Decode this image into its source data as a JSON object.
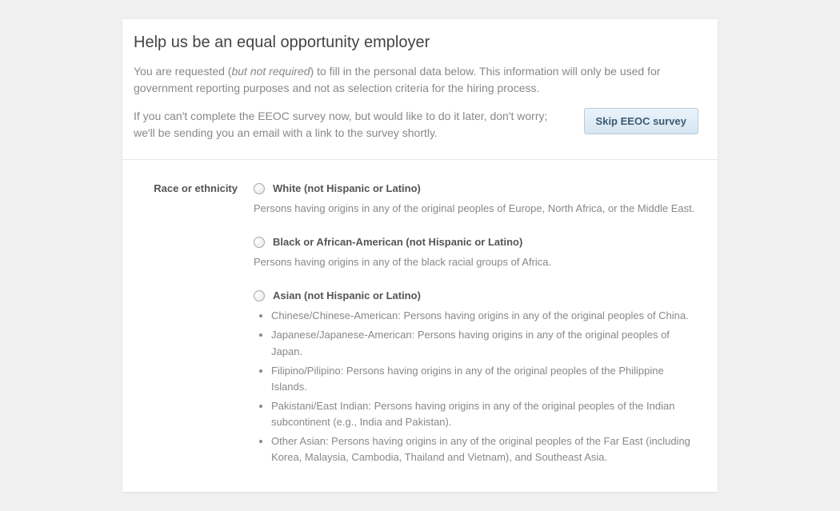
{
  "header": {
    "title": "Help us be an equal opportunity employer",
    "intro_pre": "You are requested (",
    "intro_em": "but not required",
    "intro_post": ") to fill in the personal data below. This information will only be used for government reporting purposes and not as selection criteria for the hiring process.",
    "skip_text": "If you can't complete the EEOC survey now, but would like to do it later, don't worry; we'll be sending you an email with a link to the survey shortly.",
    "skip_button": "Skip EEOC survey"
  },
  "form": {
    "section_label": "Race or ethnicity",
    "options": [
      {
        "title": "White (not Hispanic or Latino)",
        "desc": "Persons having origins in any of the original peoples of Europe, North Africa, or the Middle East."
      },
      {
        "title": "Black or African-American (not Hispanic or Latino)",
        "desc": "Persons having origins in any of the black racial groups of Africa."
      },
      {
        "title": "Asian (not Hispanic or Latino)",
        "sub": [
          "Chinese/Chinese-American: Persons having origins in any of the original peoples of China.",
          "Japanese/Japanese-American: Persons having origins in any of the original peoples of Japan.",
          "Filipino/Pilipino: Persons having origins in any of the original peoples of the Philippine Islands.",
          "Pakistani/East Indian: Persons having origins in any of the original peoples of the Indian subcontinent (e.g., India and Pakistan).",
          "Other Asian: Persons having origins in any of the original peoples of the Far East (including Korea, Malaysia, Cambodia, Thailand and Vietnam), and Southeast Asia."
        ]
      }
    ]
  }
}
